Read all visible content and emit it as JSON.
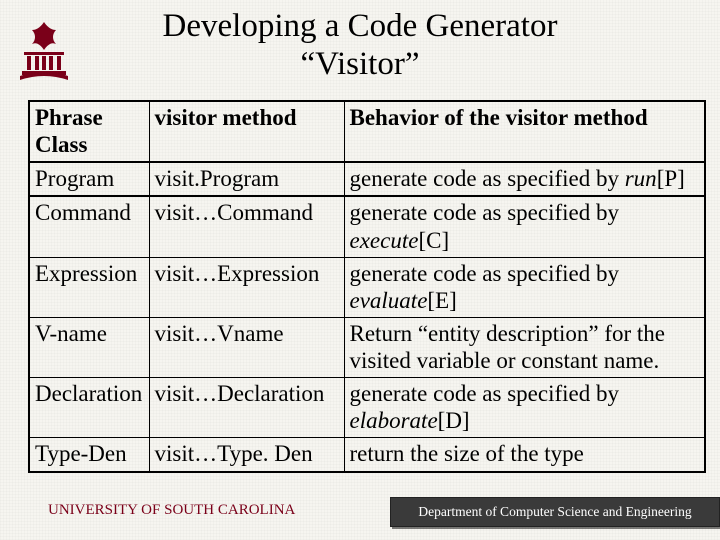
{
  "title_line1": "Developing a Code Generator",
  "title_line2": "“Visitor”",
  "table": {
    "header": {
      "c1a": "Phrase",
      "c1b": "Class",
      "c2": "visitor method",
      "c3": "Behavior of the visitor method"
    },
    "rows": [
      {
        "c1": "Program",
        "c2": "visit.Program",
        "c3_pre": "generate code as specified by ",
        "c3_it": "run",
        "c3_post": "[P]"
      },
      {
        "c1": "Command",
        "c2": "visit…Command",
        "c3_pre": "generate code as specified by ",
        "c3_it": "execute",
        "c3_post": "[C]"
      },
      {
        "c1": "Expression",
        "c2": "visit…Expression",
        "c3_pre": "generate code as specified by ",
        "c3_it": "evaluate",
        "c3_post": "[E]"
      },
      {
        "c1": "V-name",
        "c2": "visit…Vname",
        "c3_pre": "Return “entity description” for the visited variable or constant name.",
        "c3_it": "",
        "c3_post": ""
      },
      {
        "c1": "Declaration",
        "c2": "visit…Declaration",
        "c3_pre": "generate code as specified by ",
        "c3_it": "elaborate",
        "c3_post": "[D]"
      },
      {
        "c1": "Type-Den",
        "c2": "visit…Type. Den",
        "c3_pre": "return the size of the type",
        "c3_it": "",
        "c3_post": ""
      }
    ]
  },
  "footer_left": "UNIVERSITY OF SOUTH CAROLINA",
  "footer_right": "Department of Computer Science and Engineering",
  "logo_color": "#7a0019"
}
